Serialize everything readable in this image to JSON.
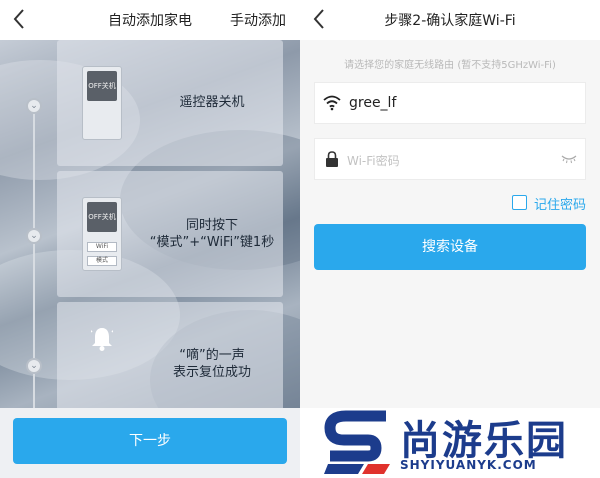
{
  "left_screen": {
    "title": "自动添加家电",
    "manual_add": "手动添加",
    "steps": [
      {
        "screen_text": "OFF关机",
        "label": "遥控器关机"
      },
      {
        "screen_text": "OFF关机",
        "key_wifi": "WiFi",
        "key_mode": "模式",
        "label_line1": "同时按下",
        "label_line2": "“模式”+“WiFi”键1秒"
      },
      {
        "label_line1": "“嘀”的一声",
        "label_line2": "表示复位成功"
      }
    ],
    "next_button": "下一步"
  },
  "right_screen": {
    "title": "步骤2-确认家庭Wi-Fi",
    "hint": "请选择您的家庭无线路由 (暂不支持5GHzWi-Fi)",
    "ssid_value": "gree_lf",
    "password_placeholder": "Wi-Fi密码",
    "remember_password": "记住密码",
    "search_button": "搜索设备"
  },
  "watermark": {
    "cn": "尚游乐园",
    "en": "SHYIYUANYK.COM"
  },
  "colors": {
    "accent": "#2aa8ec",
    "watermark_blue": "#1c3c8c",
    "watermark_red": "#e0312c"
  },
  "icons": [
    "back-arrow-icon",
    "chevron-down-icon",
    "bell-icon",
    "wifi-icon",
    "lock-icon",
    "eye-closed-icon",
    "checkbox-icon"
  ]
}
